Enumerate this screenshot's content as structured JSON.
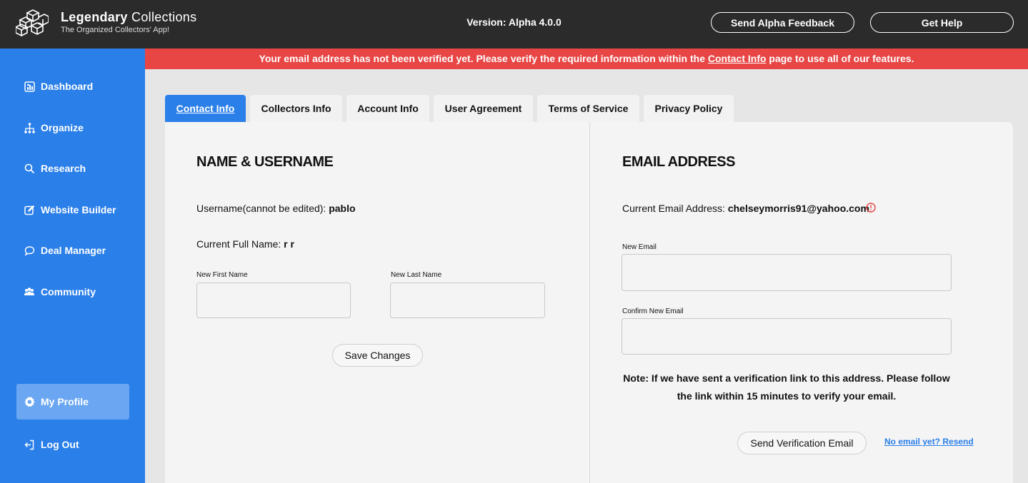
{
  "header": {
    "brand_name_bold": "Legendary",
    "brand_name_rest": " Collections",
    "tagline": "The Organized Collectors' App!",
    "version": "Version: Alpha 4.0.0",
    "feedback_label": "Send Alpha Feedback",
    "help_label": "Get Help"
  },
  "sidebar": {
    "items": [
      {
        "label": "Dashboard",
        "icon": "dashboard-icon"
      },
      {
        "label": "Organize",
        "icon": "hierarchy-icon"
      },
      {
        "label": "Research",
        "icon": "search-icon"
      },
      {
        "label": "Website Builder",
        "icon": "edit-icon"
      },
      {
        "label": "Deal Manager",
        "icon": "chat-icon"
      },
      {
        "label": "Community",
        "icon": "people-icon"
      }
    ],
    "profile_label": "My Profile",
    "logout_label": "Log Out"
  },
  "banner": {
    "text_before": "Your email address has not been verified yet. Please verify the required information within the ",
    "link": "Contact Info",
    "text_after": " page to use all of our features."
  },
  "tabs": [
    {
      "label": "Contact Info",
      "active": true
    },
    {
      "label": "Collectors Info",
      "active": false
    },
    {
      "label": "Account Info",
      "active": false
    },
    {
      "label": "User Agreement",
      "active": false
    },
    {
      "label": "Terms of Service",
      "active": false
    },
    {
      "label": "Privacy Policy",
      "active": false
    }
  ],
  "name_section": {
    "title": "NAME & USERNAME",
    "username_label": "Username(cannot be edited): ",
    "username_value": "pablo",
    "fullname_label": "Current Full Name: ",
    "fullname_value": "r r",
    "first_name_label": "New First Name",
    "first_name_value": "",
    "last_name_label": "New Last Name",
    "last_name_value": "",
    "save_label": "Save Changes"
  },
  "email_section": {
    "title": "EMAIL ADDRESS",
    "current_label": "Current Email Address: ",
    "current_value": "chelseymorris91@yahoo.com",
    "new_email_label": "New Email",
    "new_email_value": "",
    "confirm_email_label": "Confirm New Email",
    "confirm_email_value": "",
    "note": "Note: If we have sent a verification link to this address. Please follow the link within 15 minutes to verify your email.",
    "send_label": "Send Verification Email",
    "resend_label": "No email yet? Resend"
  },
  "colors": {
    "accent": "#2a7fe9",
    "banner": "#e84545",
    "topbar": "#2b2b2b",
    "warning": "#e84545"
  }
}
